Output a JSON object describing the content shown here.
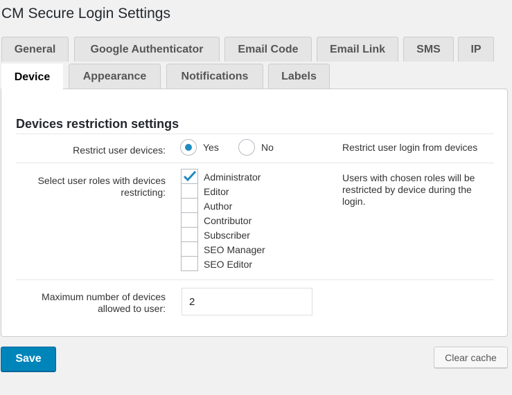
{
  "page": {
    "title": "CM Secure Login Settings"
  },
  "tabs_row1": [
    {
      "label": "General",
      "active": false
    },
    {
      "label": "Google Authenticator",
      "active": false
    },
    {
      "label": "Email Code",
      "active": false
    },
    {
      "label": "Email Link",
      "active": false
    },
    {
      "label": "SMS",
      "active": false
    },
    {
      "label": "IP",
      "active": false
    }
  ],
  "tabs_row2": [
    {
      "label": "Device",
      "active": true
    },
    {
      "label": "Appearance",
      "active": false
    },
    {
      "label": "Notifications",
      "active": false
    },
    {
      "label": "Labels",
      "active": false
    }
  ],
  "section": {
    "title": "Devices restriction settings",
    "restrict": {
      "label": "Restrict user devices:",
      "options": [
        {
          "label": "Yes",
          "checked": true
        },
        {
          "label": "No",
          "checked": false
        }
      ],
      "help": "Restrict user login from devices"
    },
    "roles": {
      "label": "Select user roles with devices restricting:",
      "items": [
        {
          "label": "Administrator",
          "checked": true
        },
        {
          "label": "Editor",
          "checked": false
        },
        {
          "label": "Author",
          "checked": false
        },
        {
          "label": "Contributor",
          "checked": false
        },
        {
          "label": "Subscriber",
          "checked": false
        },
        {
          "label": "SEO Manager",
          "checked": false
        },
        {
          "label": "SEO Editor",
          "checked": false
        }
      ],
      "help": "Users with chosen roles will be restricted by device during the login."
    },
    "max_devices": {
      "label": "Maximum number of devices allowed to user:",
      "value": "2"
    }
  },
  "buttons": {
    "save": "Save",
    "clear_cache": "Clear cache"
  },
  "colors": {
    "accent": "#0085ba",
    "radio_dot": "#1e8cbe",
    "check": "#1e8cbe"
  }
}
